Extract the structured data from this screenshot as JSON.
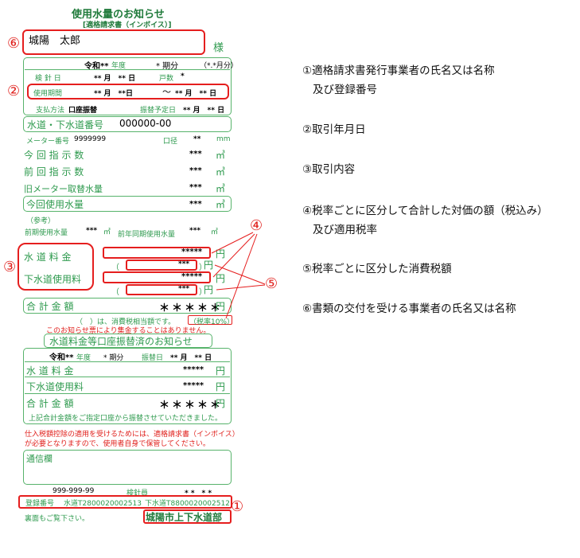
{
  "header": {
    "title": "使用水量のお知らせ",
    "subtitle": "[適格請求書（インボイス）]"
  },
  "customer": {
    "name": "城陽　太郎",
    "honorific": "様"
  },
  "period": {
    "era": "令和**",
    "year_label": "年度",
    "term": "* 期分",
    "term_note": "（*.*月分）",
    "inspection_label": "検 針 日",
    "inspection_value": "** 月　** 日",
    "households_label": "戸数",
    "households_value": "*",
    "usage_period_label": "使用期間",
    "usage_from": "** 月　**日",
    "usage_sep": "～",
    "usage_to": "** 月　** 日",
    "payment_method_label": "支払方法",
    "payment_method_value": "口座振替",
    "transfer_date_label": "振替予定日",
    "transfer_date_value": "** 月　** 日"
  },
  "account": {
    "label": "水道・下水道番号",
    "value": "000000-00"
  },
  "meter": {
    "number_label": "メーター番号",
    "number_value": "9999999",
    "bore_label": "口径",
    "bore_value": "**",
    "bore_unit": "mm"
  },
  "readings": [
    {
      "label": "今 回 指 示 数",
      "value": "***",
      "unit": "㎥"
    },
    {
      "label": "前 回 指 示 数",
      "value": "***",
      "unit": "㎥"
    },
    {
      "label": "旧メーター取替水量",
      "value": "***",
      "unit": "㎥"
    }
  ],
  "current_usage": {
    "label": "今回使用水量",
    "value": "***",
    "unit": "㎥"
  },
  "reference": {
    "label": "（参考）",
    "prev_label": "前期使用水量",
    "prev_value": "***",
    "prev_unit": "㎥",
    "prev_year_label": "前年同期使用水量",
    "prev_year_value": "***",
    "prev_year_unit": "㎥"
  },
  "charges": {
    "water_label": "水 道 料 金",
    "water_value": "*****",
    "water_tax": "***",
    "sewer_label": "下水道使用料",
    "sewer_value": "*****",
    "sewer_tax": "***",
    "unit": "円",
    "paren_open": "（",
    "paren_close": "）",
    "total_label": "合 計 金 額",
    "total_value": "＊＊＊＊＊",
    "tax_note": "（　）は、消費税相当額です。",
    "tax_rate": "（税率10%）",
    "notice": "このお知らせ票により集金することはありません。"
  },
  "transfer": {
    "title": "水道料金等口座振替済のお知らせ",
    "era": "令和**",
    "year_label": "年度",
    "term": "* 期分",
    "date_label": "振替日",
    "date_value": "** 月　** 日",
    "water_label": "水 道 料 金",
    "water_value": "*****",
    "sewer_label": "下水道使用料",
    "sewer_value": "*****",
    "total_label": "合 計 金 額",
    "total_value": "＊＊＊＊＊",
    "unit": "円",
    "note": "上記合計金額をご指定口座から振替させていただきました。"
  },
  "invoice_notice": {
    "line1": "仕入税額控除の適用を受けるためには、適格請求書（インボイス）",
    "line2": "が必要となりますので、使用者自身で保管してください。"
  },
  "memo": {
    "label": "通信欄"
  },
  "footer": {
    "phone": "999-999-99",
    "meter_reader_label": "検針員",
    "meter_reader_value": "* *　* *",
    "reg_label": "登録番号",
    "reg_water": "水道T2800020002513",
    "reg_sewer": "下水道T8800020002512",
    "back_note": "裏面もご覧下さい。",
    "issuer": "城陽市上下水道部"
  },
  "markers": {
    "m1": "①",
    "m2": "②",
    "m3": "③",
    "m4": "④",
    "m5": "⑤",
    "m6": "⑥"
  },
  "legend": {
    "item1_line1": "①適格請求書発行事業者の氏名又は名称",
    "item1_line2": "及び登録番号",
    "item2": "②取引年月日",
    "item3": "③取引内容",
    "item4_line1": "④税率ごとに区分して合計した対価の額（税込み）",
    "item4_line2": "及び適用税率",
    "item5": "⑤税率ごとに区分した消費税額",
    "item6": "⑥書類の交付を受ける事業者の氏名又は名称"
  },
  "colors": {
    "green": "#2e9a4e",
    "red": "#e51e1e"
  }
}
